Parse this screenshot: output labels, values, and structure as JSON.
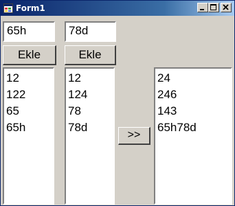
{
  "window": {
    "title": "Form1",
    "controls": [
      "minimize-icon",
      "maximize-icon",
      "close-icon"
    ]
  },
  "left": {
    "input_value": "65h",
    "add_button_label": "Ekle",
    "list_items": [
      "12",
      "122",
      "65",
      "65h"
    ]
  },
  "middle": {
    "input_value": "78d",
    "add_button_label": "Ekle",
    "list_items": [
      "12",
      "124",
      "78",
      "78d"
    ]
  },
  "combine_button_label": ">>",
  "result": {
    "list_items": [
      "24",
      "246",
      "143",
      "65h78d"
    ]
  },
  "colors": {
    "title_bar_start": "#0a246a",
    "title_bar_end": "#a6caf0",
    "face": "#d4d0c8"
  }
}
